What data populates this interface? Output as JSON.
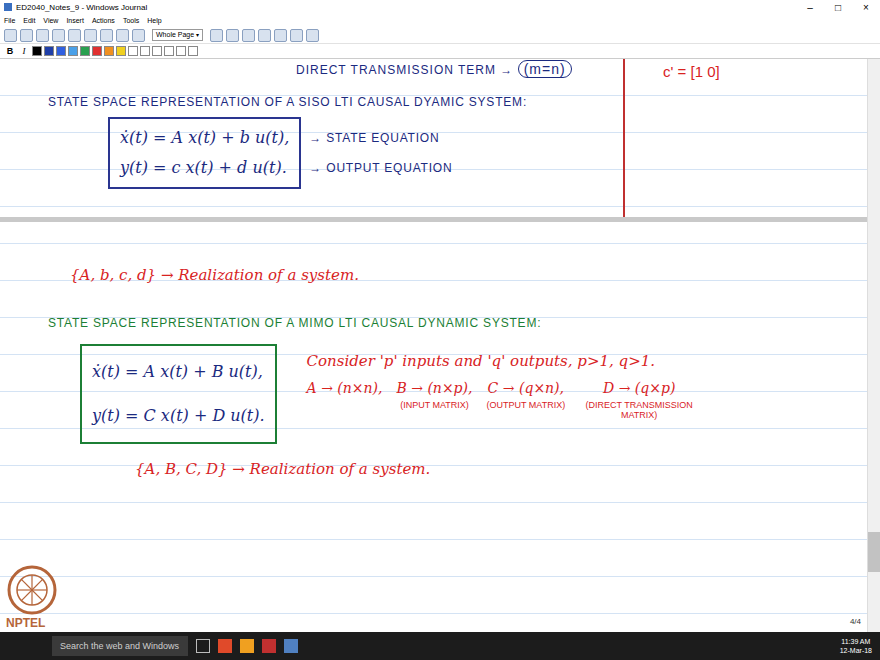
{
  "window": {
    "title": "ED2040_Notes_9 - Windows Journal",
    "controls": [
      "–",
      "□",
      "×"
    ]
  },
  "menu": [
    "File",
    "Edit",
    "View",
    "Insert",
    "Actions",
    "Tools",
    "Help"
  ],
  "toolbar": {
    "zoom": "Whole Page",
    "bold": "B",
    "italic": "I"
  },
  "pen_colors": [
    {
      "color": "#000000"
    },
    {
      "color": "#1f3fa8"
    },
    {
      "color": "#3060e0"
    },
    {
      "color": "#4aa0e8"
    },
    {
      "color": "#2aa050"
    },
    {
      "color": "#e03030"
    },
    {
      "color": "#f09020"
    },
    {
      "color": "#f0d020"
    },
    {
      "color": "#ffffff"
    },
    {
      "color": "#ffffff"
    },
    {
      "color": "#ffffff"
    },
    {
      "color": "#ffffff"
    },
    {
      "color": "#ffffff"
    },
    {
      "color": "#ffffff"
    }
  ],
  "previous_page": {
    "direct_term": "DIRECT TRANSMISSION TERM →",
    "direct_term_value": "(m=n)",
    "side_note": "c' = [1 0]",
    "siso_heading": "STATE SPACE REPRESENTATION OF A SISO LTI CAUSAL DYAMIC SYSTEM:",
    "siso_equations": [
      {
        "equation": "ẋ(t) = A x(t) + b u(t),",
        "label": "→ STATE EQUATION"
      },
      {
        "equation": "y(t) = c x(t) + d u(t).",
        "label": "→ OUTPUT EQUATION"
      }
    ]
  },
  "page": {
    "siso_realization": "{A, b, c, d} → Realization of a system.",
    "mimo_heading": "STATE SPACE REPRESENTATION OF A MIMO LTI CAUSAL DYNAMIC SYSTEM:",
    "mimo_equations": [
      "ẋ(t) = A x(t) + B u(t),",
      "y(t) = C x(t) + D u(t)."
    ],
    "consider": "Consider 'p' inputs and 'q' outputs, p>1, q>1.",
    "matrices": [
      {
        "dims": "A → (n×n),"
      },
      {
        "dims": "B → (n×p),",
        "label": "(INPUT MATRIX)"
      },
      {
        "dims": "C → (q×n),",
        "label": "(OUTPUT MATRIX)"
      },
      {
        "dims": "D → (q×p)",
        "label": "(DIRECT TRANSMISSION MATRIX)"
      }
    ],
    "mimo_realization": "{A, B, C, D} → Realization of a system."
  },
  "page_counter": "4/4",
  "watermark": "NPTEL",
  "taskbar": {
    "search": "Search the web and Windows",
    "time": "11:39 AM",
    "date": "12-Mar-18"
  }
}
